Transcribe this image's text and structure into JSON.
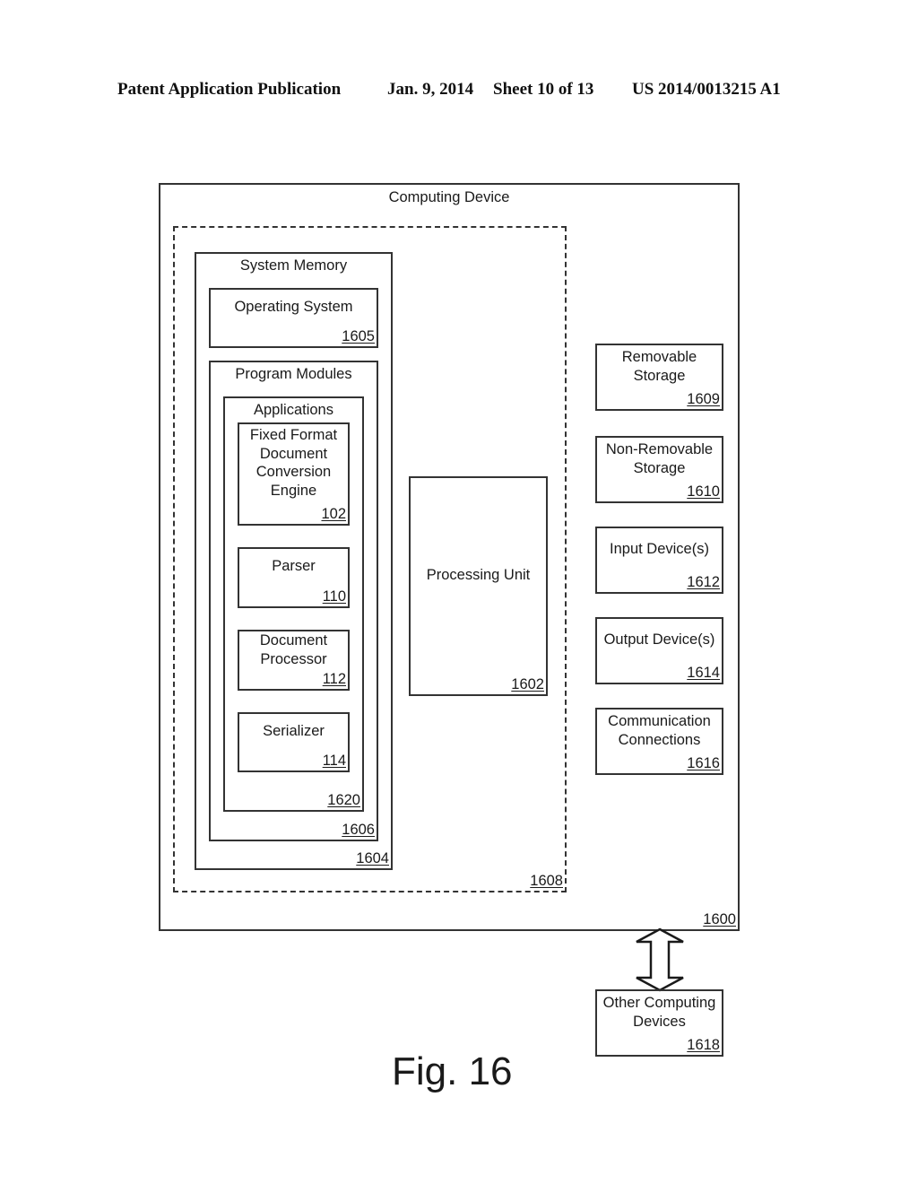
{
  "header": {
    "publication": "Patent Application Publication",
    "date": "Jan. 9, 2014",
    "sheet": "Sheet 10 of 13",
    "number": "US 2014/0013215 A1"
  },
  "diagram": {
    "computing_device": {
      "label": "Computing Device",
      "ref": "1600"
    },
    "dashed_group": {
      "ref": "1608"
    },
    "system_memory": {
      "label": "System Memory",
      "ref": "1604"
    },
    "operating_system": {
      "label": "Operating System",
      "ref": "1605"
    },
    "program_modules": {
      "label": "Program Modules",
      "ref": "1606"
    },
    "applications": {
      "label": "Applications",
      "ref": "1620"
    },
    "conversion_engine": {
      "label": "Fixed Format Document Conversion Engine",
      "ref": "102"
    },
    "parser": {
      "label": "Parser",
      "ref": "110"
    },
    "document_processor": {
      "label": "Document Processor",
      "ref": "112"
    },
    "serializer": {
      "label": "Serializer",
      "ref": "114"
    },
    "processing_unit": {
      "label": "Processing Unit",
      "ref": "1602"
    },
    "removable_storage": {
      "label": "Removable Storage",
      "ref": "1609"
    },
    "non_removable_storage": {
      "label": "Non-Removable Storage",
      "ref": "1610"
    },
    "input_devices": {
      "label": "Input Device(s)",
      "ref": "1612"
    },
    "output_devices": {
      "label": "Output Device(s)",
      "ref": "1614"
    },
    "communication_connections": {
      "label": "Communication Connections",
      "ref": "1616"
    },
    "other_computing_devices": {
      "label": "Other Computing Devices",
      "ref": "1618"
    },
    "connector": "bidirectional-arrow"
  },
  "figure_caption": "Fig. 16"
}
